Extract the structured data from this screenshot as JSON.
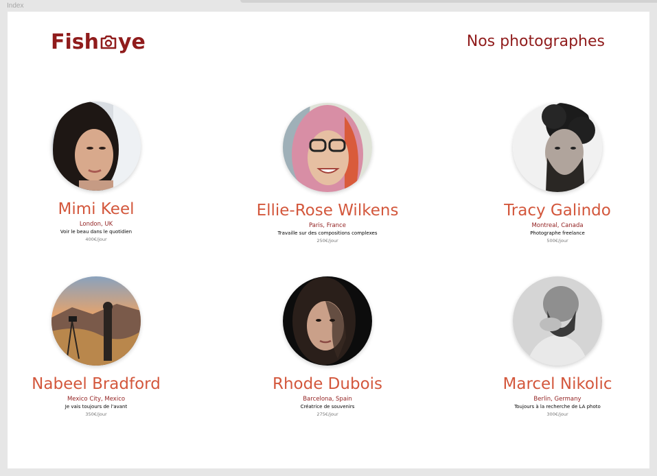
{
  "window": {
    "frame_label": "Index"
  },
  "header": {
    "logo_text_left": "Fish",
    "logo_text_right": "ye",
    "title": "Nos photographes"
  },
  "photographers": [
    {
      "name": "Mimi Keel",
      "location": "London, UK",
      "tagline": "Voir le beau dans le quotidien",
      "price": "400€/jour"
    },
    {
      "name": "Ellie-Rose Wilkens",
      "location": "Paris, France",
      "tagline": "Travaille sur des compositions complexes",
      "price": "250€/jour"
    },
    {
      "name": "Tracy Galindo",
      "location": "Montreal, Canada",
      "tagline": "Photographe freelance",
      "price": "500€/jour"
    },
    {
      "name": "Nabeel Bradford",
      "location": "Mexico City, Mexico",
      "tagline": "Je vais toujours de l'avant",
      "price": "350€/jour"
    },
    {
      "name": "Rhode Dubois",
      "location": "Barcelona, Spain",
      "tagline": "Créatrice de souvenirs",
      "price": "275€/jour"
    },
    {
      "name": "Marcel Nikolic",
      "location": "Berlin, Germany",
      "tagline": "Toujours à la recherche de LA photo",
      "price": "300€/jour"
    }
  ],
  "colors": {
    "brand": "#901c1c",
    "accent": "#d3573c",
    "muted": "#757575"
  },
  "icons": {
    "logo": "camera-icon"
  }
}
